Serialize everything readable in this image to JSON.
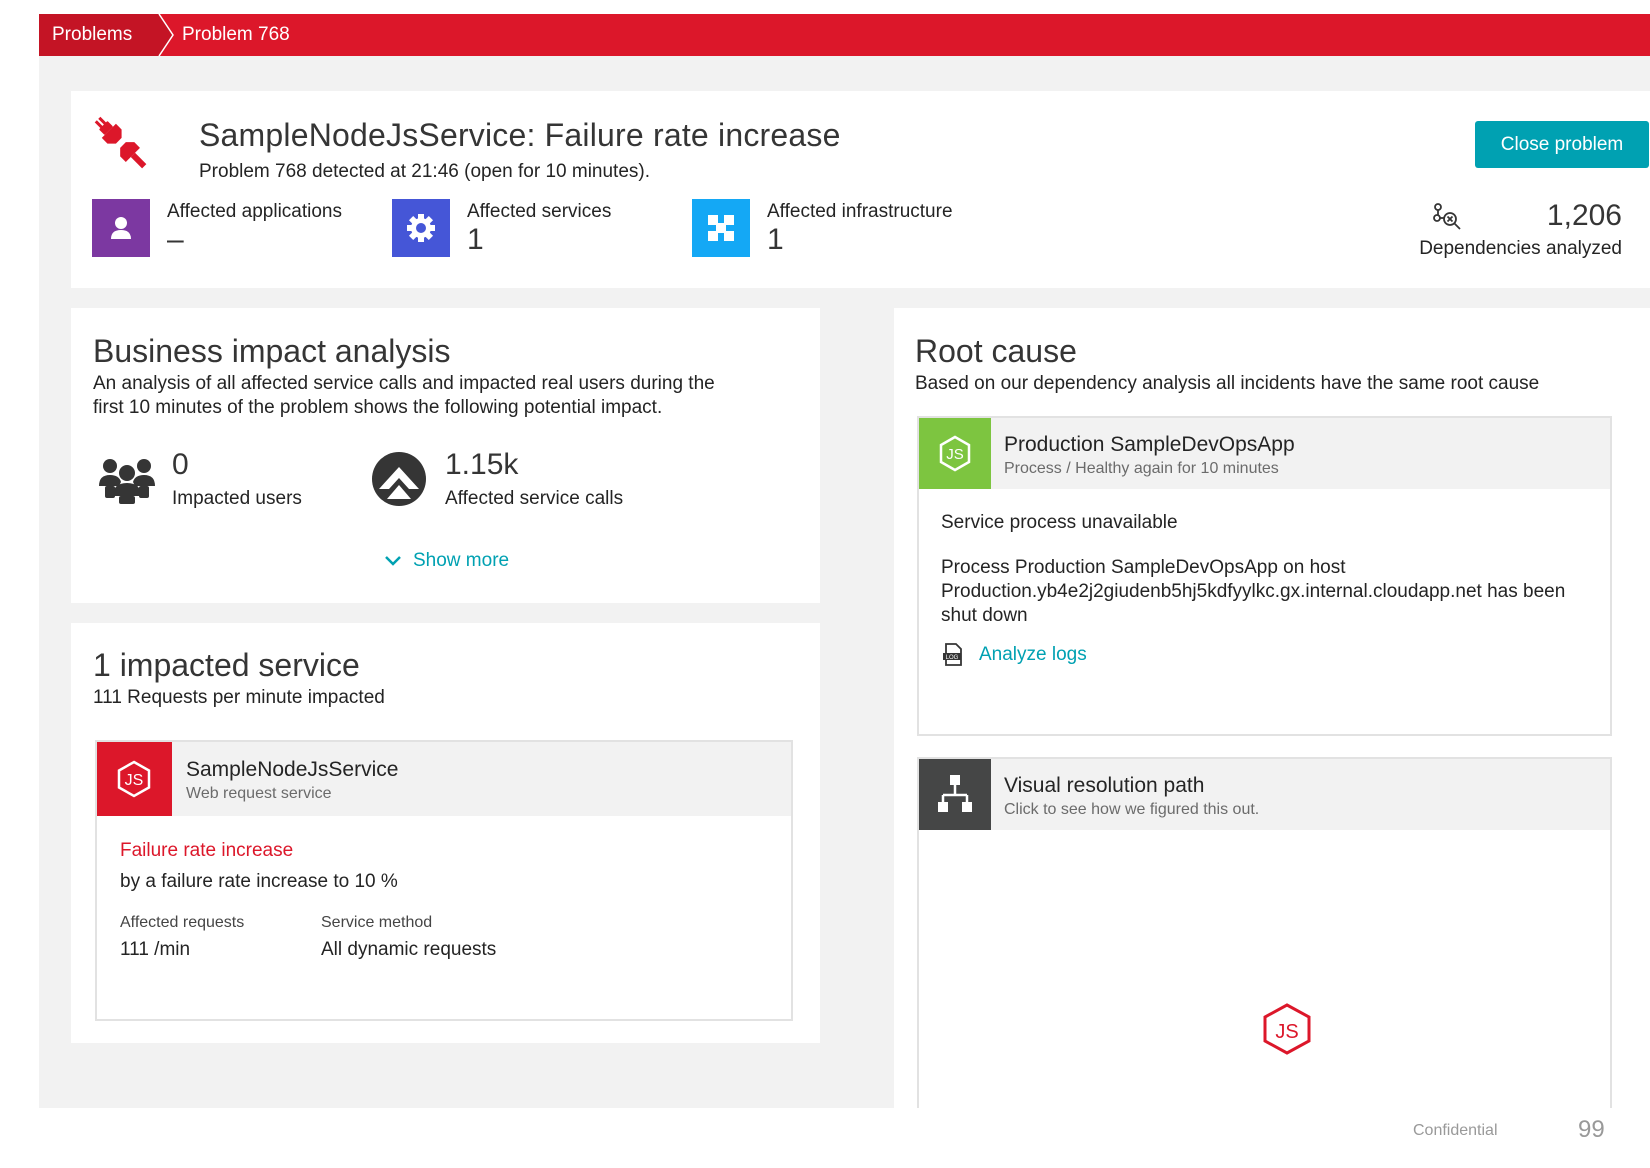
{
  "breadcrumb": {
    "items": [
      "Problems",
      "Problem 768"
    ]
  },
  "colors": {
    "brand_red": "#dc172a",
    "accent_teal": "#00a1b2",
    "process_green": "#7dc540",
    "apps_purple": "#7c38a1",
    "services_blue": "#4556d7",
    "infra_cyan": "#14a8f5"
  },
  "problem": {
    "title": "SampleNodeJsService: Failure rate increase",
    "subtitle": "Problem 768 detected at 21:46 (open for 10 minutes).",
    "close_label": "Close problem",
    "affected": [
      {
        "label": "Affected applications",
        "value": "–",
        "icon": "user-icon"
      },
      {
        "label": "Affected services",
        "value": "1",
        "icon": "gear-icon"
      },
      {
        "label": "Affected infrastructure",
        "value": "1",
        "icon": "infrastructure-icon"
      }
    ],
    "dependencies": {
      "value": "1,206",
      "label": "Dependencies analyzed",
      "icon": "dependency-search-icon"
    }
  },
  "business": {
    "title": "Business impact analysis",
    "desc1": "An analysis of all affected service calls and impacted real users during the",
    "desc2": "first 10 minutes of the problem shows the following potential impact.",
    "users_value": "0",
    "users_label": "Impacted users",
    "calls_value": "1.15k",
    "calls_label": "Affected service calls",
    "show_more": "Show more"
  },
  "impacted": {
    "title": "1 impacted service",
    "subtitle": "111 Requests per minute impacted",
    "service_name": "SampleNodeJsService",
    "service_type": "Web request service",
    "failure_title": "Failure rate increase",
    "failure_desc": "by a failure rate increase to 10 %",
    "req_label": "Affected requests",
    "req_value": "111 /min",
    "method_label": "Service method",
    "method_value": "All dynamic requests"
  },
  "root_cause": {
    "title": "Root cause",
    "desc": "Based on our dependency analysis all incidents have the same root cause",
    "process_name": "Production SampleDevOpsApp",
    "process_sub": "Process  /  Healthy again for 10 minutes",
    "event": "Service process unavailable",
    "detail1": "Process Production SampleDevOpsApp on host",
    "detail2": "Production.yb4e2j2giudenb5hj5kdfyylkc.gx.internal.cloudapp.net has been",
    "detail3": "shut down",
    "analyze_logs": "Analyze logs"
  },
  "resolution": {
    "title": "Visual resolution path",
    "subtitle": "Click to see how we figured this out."
  },
  "footer": {
    "confidential": "Confidential",
    "page": "99"
  }
}
